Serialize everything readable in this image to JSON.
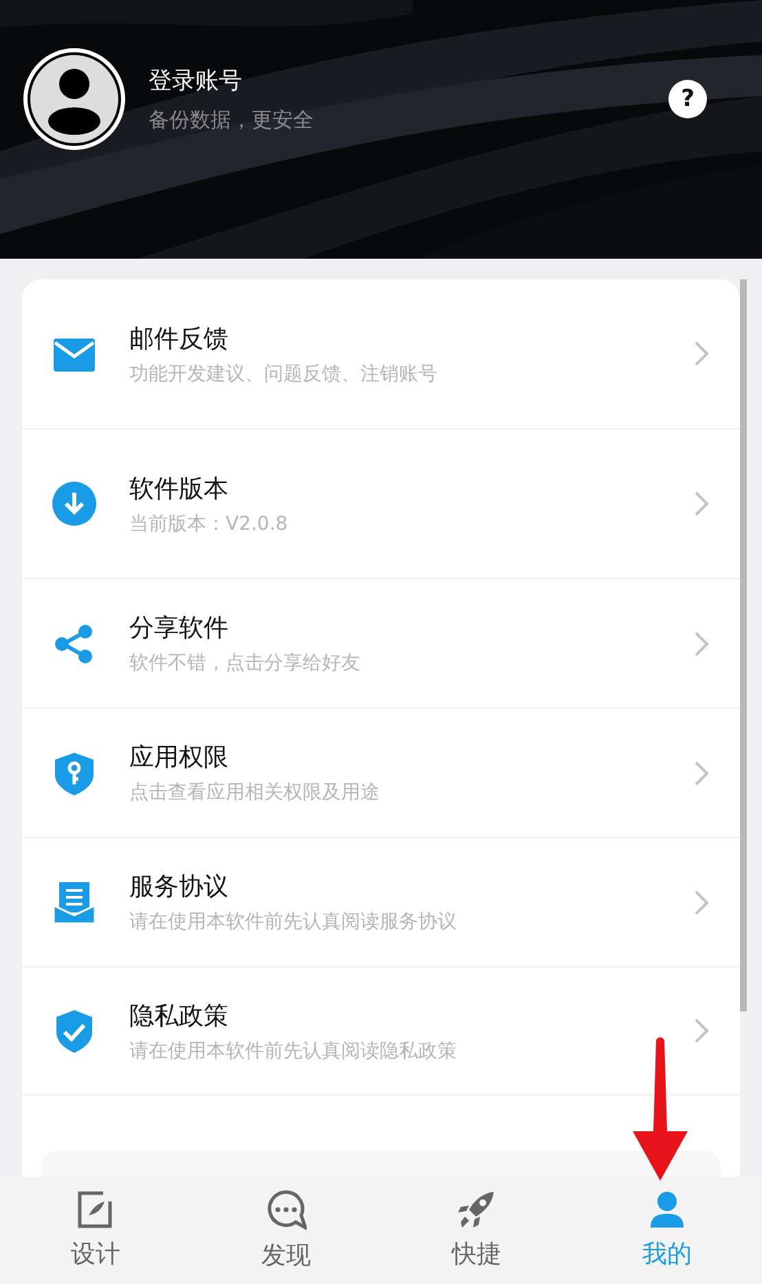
{
  "profile": {
    "title": "登录账号",
    "subtitle": "备份数据，更安全",
    "help": "?"
  },
  "menu": [
    {
      "kind": "mail",
      "title": "邮件反馈",
      "subtitle": "功能开发建议、问题反馈、注销账号"
    },
    {
      "kind": "download",
      "title": "软件版本",
      "subtitle": "当前版本：V2.0.8"
    },
    {
      "kind": "share",
      "title": "分享软件",
      "subtitle": "软件不错，点击分享给好友"
    },
    {
      "kind": "permission",
      "title": "应用权限",
      "subtitle": "点击查看应用相关权限及用途"
    },
    {
      "kind": "agreement",
      "title": "服务协议",
      "subtitle": "请在使用本软件前先认真阅读服务协议"
    },
    {
      "kind": "privacy",
      "title": "隐私政策",
      "subtitle": "请在使用本软件前先认真阅读隐私政策"
    }
  ],
  "tabs": [
    {
      "kind": "design",
      "label": "设计",
      "selected": false
    },
    {
      "kind": "discover",
      "label": "发现",
      "selected": false
    },
    {
      "kind": "shortcut",
      "label": "快捷",
      "selected": false
    },
    {
      "kind": "mine",
      "label": "我的",
      "selected": true
    }
  ]
}
